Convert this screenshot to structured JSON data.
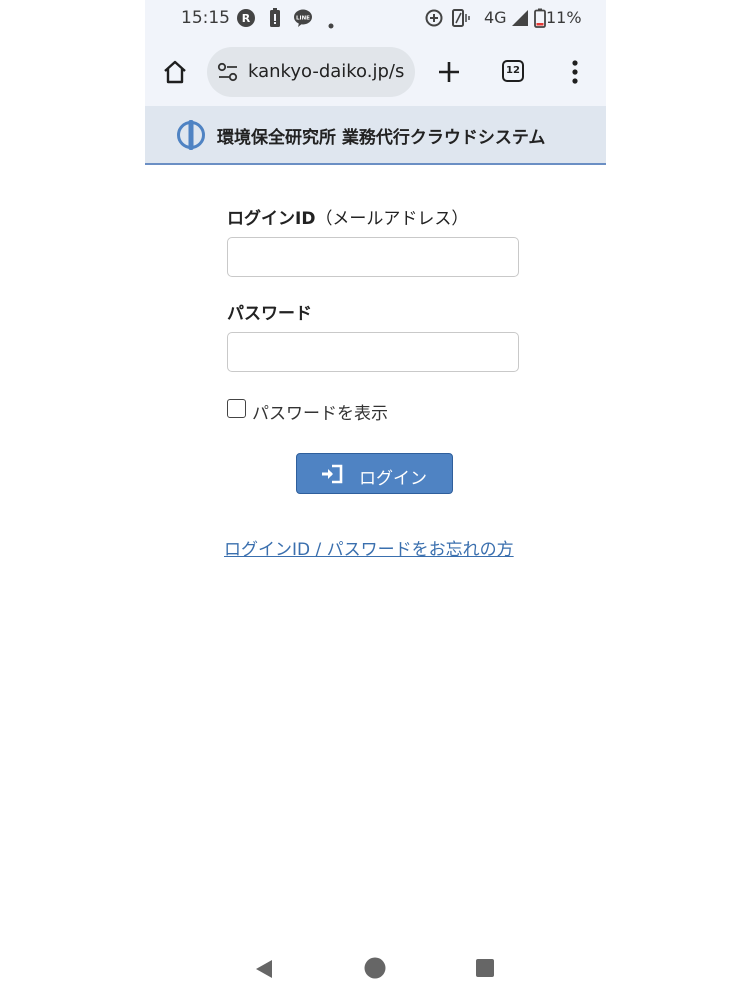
{
  "status_bar": {
    "time": "15:15",
    "network": "4G",
    "battery": "11%",
    "icons": [
      "rakuten-icon",
      "battery-saver-icon",
      "line-icon",
      "dot-icon",
      "data-saver-icon",
      "vibrate-icon",
      "signal-icon",
      "battery-icon"
    ]
  },
  "browser": {
    "url": "kankyo-daiko.jp/s",
    "tab_count": "12",
    "icons": [
      "home-icon",
      "site-settings-icon",
      "new-tab-plus-icon",
      "tabs-icon",
      "menu-dots-icon"
    ]
  },
  "site": {
    "title": "環境保全研究所 業務代行クラウドシステム",
    "brand_color": "#4f83c3",
    "logo_icon": "site-logo-icon"
  },
  "form": {
    "login_id_label_main": "ログインID",
    "login_id_label_sub": "（メールアドレス）",
    "login_id_value": "",
    "password_label": "パスワード",
    "password_value": "",
    "show_password_label": "パスワードを表示",
    "login_button_label": "ログイン",
    "forgot_link": "ログインID / パスワードをお忘れの方"
  },
  "nav_bar": {
    "icons": [
      "back-triangle-icon",
      "home-circle-icon",
      "recents-square-icon"
    ]
  }
}
